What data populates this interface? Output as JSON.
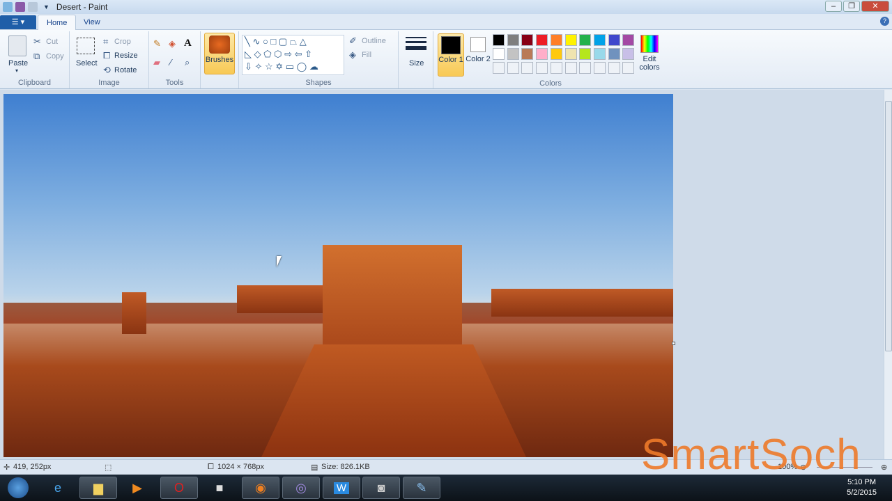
{
  "window": {
    "title": "Desert - Paint",
    "controls": [
      "minimize",
      "maximize",
      "close"
    ]
  },
  "tabs": [
    {
      "label": "Home",
      "active": true
    },
    {
      "label": "View",
      "active": false
    }
  ],
  "ribbon": {
    "clipboard": {
      "label": "Clipboard",
      "paste": "Paste",
      "cut": "Cut",
      "copy": "Copy"
    },
    "image": {
      "label": "Image",
      "select": "Select",
      "crop": "Crop",
      "resize": "Resize",
      "rotate": "Rotate"
    },
    "tools": {
      "label": "Tools"
    },
    "brushes": {
      "label": "Brushes"
    },
    "shapes": {
      "label": "Shapes",
      "outline": "Outline",
      "fill": "Fill"
    },
    "size": {
      "label": "Size"
    },
    "colors": {
      "label": "Colors",
      "color1": "Color 1",
      "color2": "Color 2",
      "edit": "Edit colors",
      "color1_value": "#000000",
      "color2_value": "#ffffff",
      "palette": [
        "#000000",
        "#7f7f7f",
        "#880015",
        "#ed1c24",
        "#ff7f27",
        "#fff200",
        "#22b14c",
        "#00a2e8",
        "#3f48cc",
        "#a349a4",
        "#ffffff",
        "#c3c3c3",
        "#b97a57",
        "#ffaec9",
        "#ffc90e",
        "#efe4b0",
        "#b5e61d",
        "#99d9ea",
        "#7092be",
        "#c8bfe7"
      ]
    }
  },
  "status": {
    "cursor_pos": "419, 252px",
    "image_size": "1024 × 768px",
    "file_size": "Size: 826.1KB",
    "zoom": "100%"
  },
  "taskbar": {
    "apps": [
      "start",
      "internet-explorer",
      "file-explorer",
      "media-player",
      "opera",
      "app",
      "firefox",
      "bittorrent",
      "wps",
      "camera",
      "paint"
    ],
    "time": "5:10 PM",
    "date": "5/2/2015"
  },
  "watermark": "SmartSoch"
}
